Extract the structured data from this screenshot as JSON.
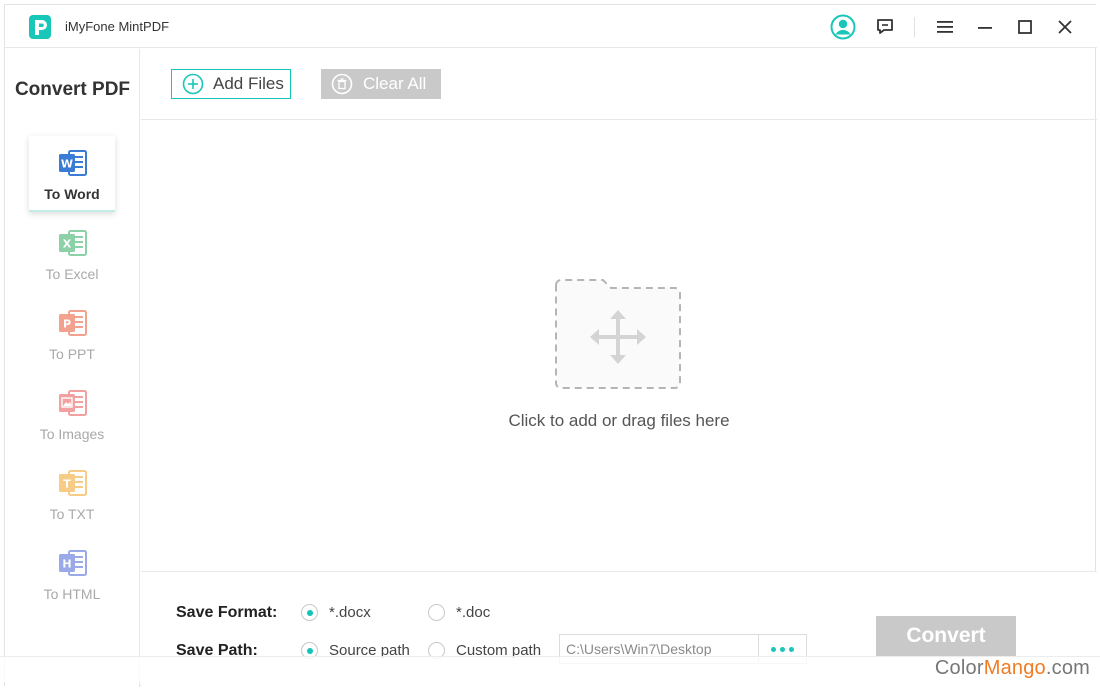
{
  "app": {
    "title": "iMyFone MintPDF",
    "accent_color": "#19c7b8"
  },
  "titlebar": {
    "icons": [
      "account-icon",
      "feedback-icon",
      "menu-icon",
      "minimize-icon",
      "maximize-icon",
      "close-icon"
    ]
  },
  "sidebar": {
    "title": "Convert PDF",
    "items": [
      {
        "label": "To Word",
        "icon": "word-icon",
        "active": true,
        "color": "#3a7bd5"
      },
      {
        "label": "To Excel",
        "icon": "excel-icon",
        "active": false,
        "color": "#8dd1a8"
      },
      {
        "label": "To PPT",
        "icon": "ppt-icon",
        "active": false,
        "color": "#f3a28f"
      },
      {
        "label": "To Images",
        "icon": "images-icon",
        "active": false,
        "color": "#f2a0a0"
      },
      {
        "label": "To TXT",
        "icon": "txt-icon",
        "active": false,
        "color": "#f6cc86"
      },
      {
        "label": "To HTML",
        "icon": "html-icon",
        "active": false,
        "color": "#9aa9e8"
      }
    ]
  },
  "toolbar": {
    "add_files_label": "Add Files",
    "clear_all_label": "Clear All"
  },
  "dropzone": {
    "hint": "Click to add or drag files here"
  },
  "options": {
    "save_format_label": "Save Format:",
    "format_options": [
      {
        "label": "*.docx",
        "selected": true
      },
      {
        "label": "*.doc",
        "selected": false
      }
    ],
    "save_path_label": "Save Path:",
    "path_options": [
      {
        "label": "Source path",
        "selected": true
      },
      {
        "label": "Custom path",
        "selected": false
      }
    ],
    "path_value": "C:\\Users\\Win7\\Desktop",
    "convert_label": "Convert"
  },
  "watermark": {
    "part1": "Color",
    "part2": "Mango",
    "part3": ".com"
  }
}
